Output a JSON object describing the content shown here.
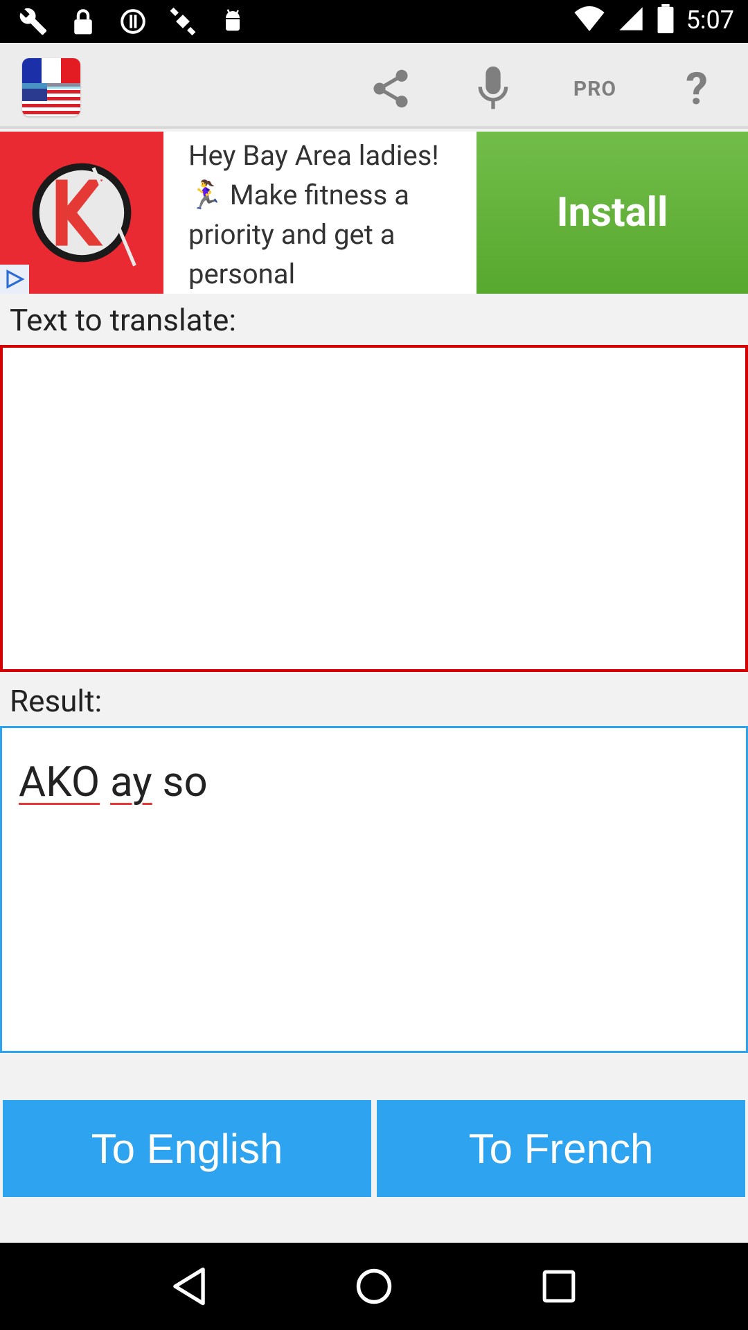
{
  "status_bar": {
    "time": "5:07",
    "icons": [
      "wrench-icon",
      "lock-icon",
      "alarm-icon",
      "gps-icon",
      "android-icon",
      "wifi-icon",
      "signal-icon",
      "battery-icon"
    ]
  },
  "toolbar": {
    "flag_icon": "us-flag-icon",
    "share_icon": "share-icon",
    "mic_icon": "microphone-icon",
    "pro_label": "PRO",
    "help_label": "?"
  },
  "ad": {
    "text": "Hey Bay Area ladies! 🏃‍♀ Make fitness a priority and get a personal",
    "install_label": "Install",
    "logo_icon": "k-logo-icon",
    "play_icon": "adchoices-play-icon"
  },
  "input_section": {
    "label": "Text to translate:",
    "value": ""
  },
  "result_section": {
    "label": "Result:",
    "words": [
      "AKO",
      "ay",
      "so"
    ]
  },
  "buttons": {
    "to_english": "To English",
    "to_french": "To French"
  },
  "nav": {
    "back_icon": "back-triangle-icon",
    "home_icon": "home-circle-icon",
    "recents_icon": "recents-square-icon"
  },
  "colors": {
    "accent_blue": "#2ea3ef",
    "input_border_red": "#d50000",
    "ad_green": "#5fad37",
    "ad_red": "#ea2a32"
  }
}
